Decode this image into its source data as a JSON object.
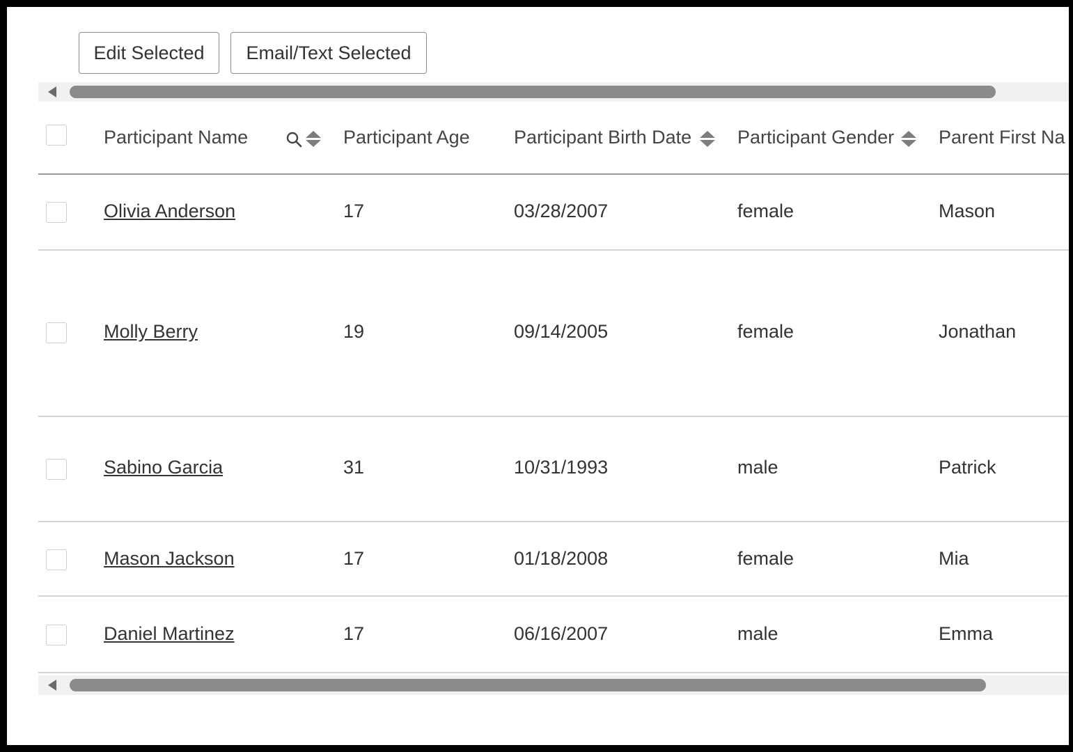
{
  "toolbar": {
    "edit_selected": "Edit Selected",
    "email_text_selected": "Email/Text Selected"
  },
  "table": {
    "headers": {
      "participant_name": "Participant Name",
      "participant_age": "Participant Age",
      "participant_birth_date": "Participant Birth Date",
      "participant_gender": "Participant Gender",
      "parent_first_name": "Parent First Na"
    },
    "rows": [
      {
        "name": "Olivia Anderson",
        "age": "17",
        "birth_date": "03/28/2007",
        "gender": "female",
        "parent_first": "Mason"
      },
      {
        "name": "Molly Berry",
        "age": "19",
        "birth_date": "09/14/2005",
        "gender": "female",
        "parent_first": "Jonathan"
      },
      {
        "name": "Sabino Garcia",
        "age": "31",
        "birth_date": "10/31/1993",
        "gender": "male",
        "parent_first": "Patrick"
      },
      {
        "name": "Mason Jackson",
        "age": "17",
        "birth_date": "01/18/2008",
        "gender": "female",
        "parent_first": "Mia"
      },
      {
        "name": "Daniel Martinez",
        "age": "17",
        "birth_date": "06/16/2007",
        "gender": "male",
        "parent_first": "Emma"
      }
    ]
  },
  "icons": {
    "search": "search-icon",
    "sort": "sort-icon",
    "scroll_left": "left-arrow-icon"
  },
  "colors": {
    "scroll_thumb": "#8b8b8b",
    "scroll_track": "#f1f1f1",
    "row_divider": "#d4d4d4",
    "header_divider": "#9a9a9a"
  }
}
